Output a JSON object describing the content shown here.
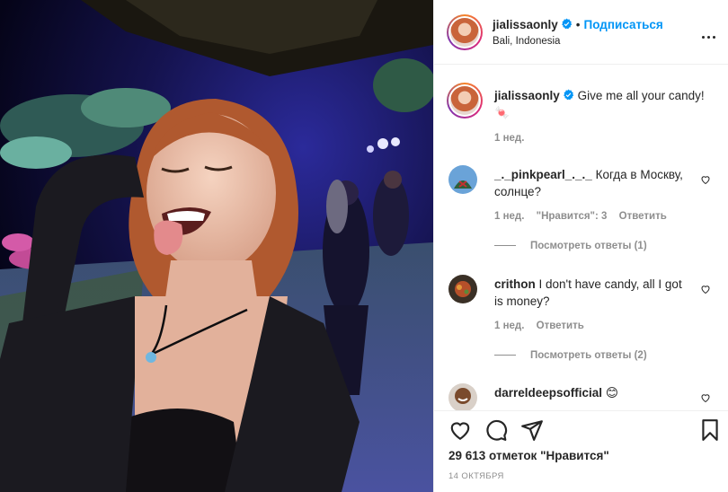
{
  "post": {
    "photo_alt": "selfie photo",
    "header": {
      "username": "jialissaonly",
      "separator": "•",
      "follow_label": "Подписаться",
      "location": "Bali, Indonesia"
    },
    "caption": {
      "username": "jialissaonly",
      "text": "Give me all your candy! 🍬",
      "time": "1 нед."
    },
    "comments": [
      {
        "username": "_._pinkpearl_._._",
        "text": "Когда в Москву, солнце?",
        "time": "1 нед.",
        "likes": "\"Нравится\": 3",
        "reply_label": "Ответить",
        "view_replies": "Посмотреть ответы (1)",
        "avatar_color": "#6aa3d8"
      },
      {
        "username": "crithon",
        "text": "I don't have candy, all I got is money?",
        "time": "1 нед.",
        "reply_label": "Ответить",
        "view_replies": "Посмотреть ответы (2)",
        "avatar_color": "#3a3026"
      },
      {
        "username": "darreldeepsofficial",
        "text": "😊",
        "avatar_color": "#7a4a2c"
      }
    ],
    "likes_count": "29 613 отметок \"Нравится\"",
    "date": "14 ОКТЯБРЯ",
    "colors": {
      "accent": "#0095f6",
      "text": "#262626",
      "secondary": "#8e8e8e",
      "border": "#efefef"
    },
    "icons": [
      "verified-icon",
      "more-options-icon",
      "heart-icon",
      "comment-icon",
      "share-icon",
      "bookmark-icon"
    ]
  }
}
